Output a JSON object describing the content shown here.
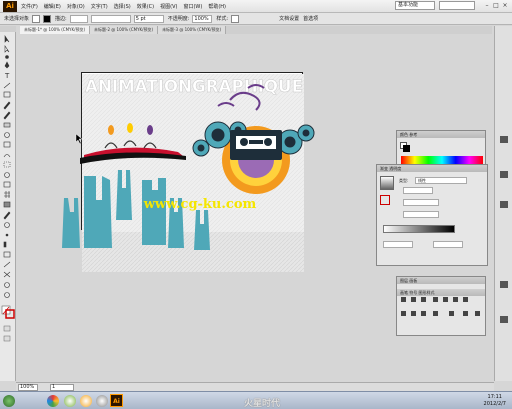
{
  "app": {
    "logo_text": "Ai"
  },
  "menubar": {
    "items": [
      "文件(F)",
      "编辑(E)",
      "对象(O)",
      "文字(T)",
      "选择(S)",
      "效果(C)",
      "视图(V)",
      "窗口(W)",
      "帮助(H)"
    ],
    "workspace": "基本功能",
    "window_buttons": [
      "–",
      "□",
      "×"
    ]
  },
  "controlbar": {
    "selection_label": "未选择对象",
    "stroke_label": "描边:",
    "stroke_weight": "5 pt",
    "opacity_label": "不透明度:",
    "opacity_value": "100%",
    "style_label": "样式:",
    "doc_setup": "文档设置",
    "preferences": "首选项"
  },
  "tabs": [
    {
      "label": "未标题-1* @ 100% (CMYK/预览)",
      "active": true
    },
    {
      "label": "未标题-2 @ 100% (CMYK/预览)",
      "active": false
    },
    {
      "label": "未标题-3 @ 100% (CMYK/预览)",
      "active": false
    }
  ],
  "artwork": {
    "headline": "ANIMATIONGRAPHIQUE",
    "watermark": "www.cg-ku.com",
    "colors": {
      "teal": "#4fa8b8",
      "dark": "#1e2e3a",
      "orange": "#f39a1e",
      "purple": "#6a3d8a",
      "yellow": "#f5e600",
      "red": "#c8102e"
    }
  },
  "panels": {
    "color": {
      "tabs": "颜色 参考"
    },
    "gradient": {
      "tabs": "渐变 透明度",
      "type_label": "类型:",
      "type_value": "线性"
    },
    "layers": {
      "tabs": "图层 画板"
    },
    "symbols": {
      "tabs": "画笔 符号 图形样式"
    }
  },
  "status": {
    "zoom": "100%",
    "page": "1"
  },
  "taskbar": {
    "watermark": "火星时代",
    "clock_time": "17:11",
    "clock_date": "2012/2/7"
  }
}
